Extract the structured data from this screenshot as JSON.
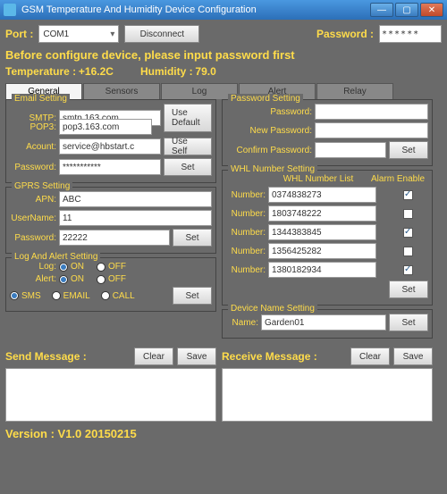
{
  "window": {
    "title": "GSM Temperature And Humidity Device Configuration"
  },
  "port": {
    "label": "Port :",
    "value": "COM1",
    "disconnect": "Disconnect"
  },
  "password": {
    "label": "Password :",
    "value": "******"
  },
  "warning": "Before configure device, please input password first",
  "temp": {
    "label": "Temperature :",
    "value": "+16.2C"
  },
  "hum": {
    "label": "Humidity :",
    "value": "79.0"
  },
  "tabs": {
    "general": "General",
    "sensors": "Sensors",
    "log": "Log",
    "alert": "Alert",
    "relay": "Relay"
  },
  "email": {
    "title": "Email Setting",
    "smtp_l": "SMTP:",
    "smtp": "smtp.163.com",
    "pop3_l": "POP3:",
    "pop3": "pop3.163.com",
    "acc_l": "Acount:",
    "acc": "service@hbstart.c",
    "pw_l": "Password:",
    "pw": "***********",
    "use_default": "Use Default",
    "use_self": "Use Self",
    "set": "Set"
  },
  "gprs": {
    "title": "GPRS Setting",
    "apn_l": "APN:",
    "apn": "ABC",
    "user_l": "UserName:",
    "user": "11",
    "pw_l": "Password:",
    "pw": "22222",
    "set": "Set"
  },
  "logalert": {
    "title": "Log And Alert Setting",
    "log_l": "Log:",
    "alert_l": "Alert:",
    "on": "ON",
    "off": "OFF",
    "sms": "SMS",
    "email": "EMAIL",
    "call": "CALL",
    "set": "Set"
  },
  "pwset": {
    "title": "Password Setting",
    "pw_l": "Password:",
    "new_l": "New Password:",
    "conf_l": "Confirm Password:",
    "set": "Set"
  },
  "whl": {
    "title": "WHL Number Setting",
    "list_h": "WHL Number List",
    "alarm_h": "Alarm Enable",
    "num_l": "Number:",
    "n1": "0374838273",
    "n2": "1803748222",
    "n3": "1344383845",
    "n4": "1356425282",
    "n5": "1380182934",
    "set": "Set"
  },
  "dev": {
    "title": "Device Name Setting",
    "name_l": "Name:",
    "name": "Garden01",
    "set": "Set"
  },
  "send": {
    "title": "Send Message :",
    "clear": "Clear",
    "save": "Save"
  },
  "recv": {
    "title": "Receive Message :",
    "clear": "Clear",
    "save": "Save"
  },
  "version": "Version : V1.0 20150215"
}
